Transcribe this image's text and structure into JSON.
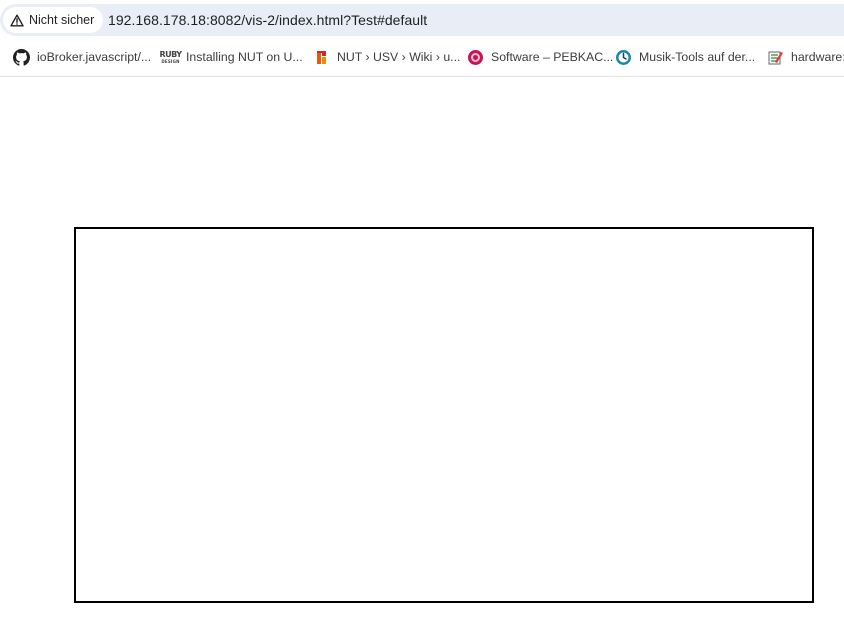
{
  "browser": {
    "security_chip": {
      "icon": "warning-triangle-icon",
      "label": "Nicht sicher"
    },
    "url": "192.168.178.18:8082/vis-2/index.html?Test#default"
  },
  "bookmarks": [
    {
      "icon": "github-icon",
      "label": "ioBroker.javascript/..."
    },
    {
      "icon": "ruby-design-icon",
      "label": "Installing NUT on U..."
    },
    {
      "icon": "nut-logo-icon",
      "label": "NUT › USV › Wiki › u..."
    },
    {
      "icon": "pebkac-icon",
      "label": "Software – PEBKAC..."
    },
    {
      "icon": "musik-tools-icon",
      "label": "Musik-Tools auf der..."
    },
    {
      "icon": "hardware-icon",
      "label": "hardware:d"
    }
  ],
  "colors": {
    "omnibox_bg": "#e9eef6",
    "frame_border": "#000000",
    "page_bg": "#ffffff"
  }
}
